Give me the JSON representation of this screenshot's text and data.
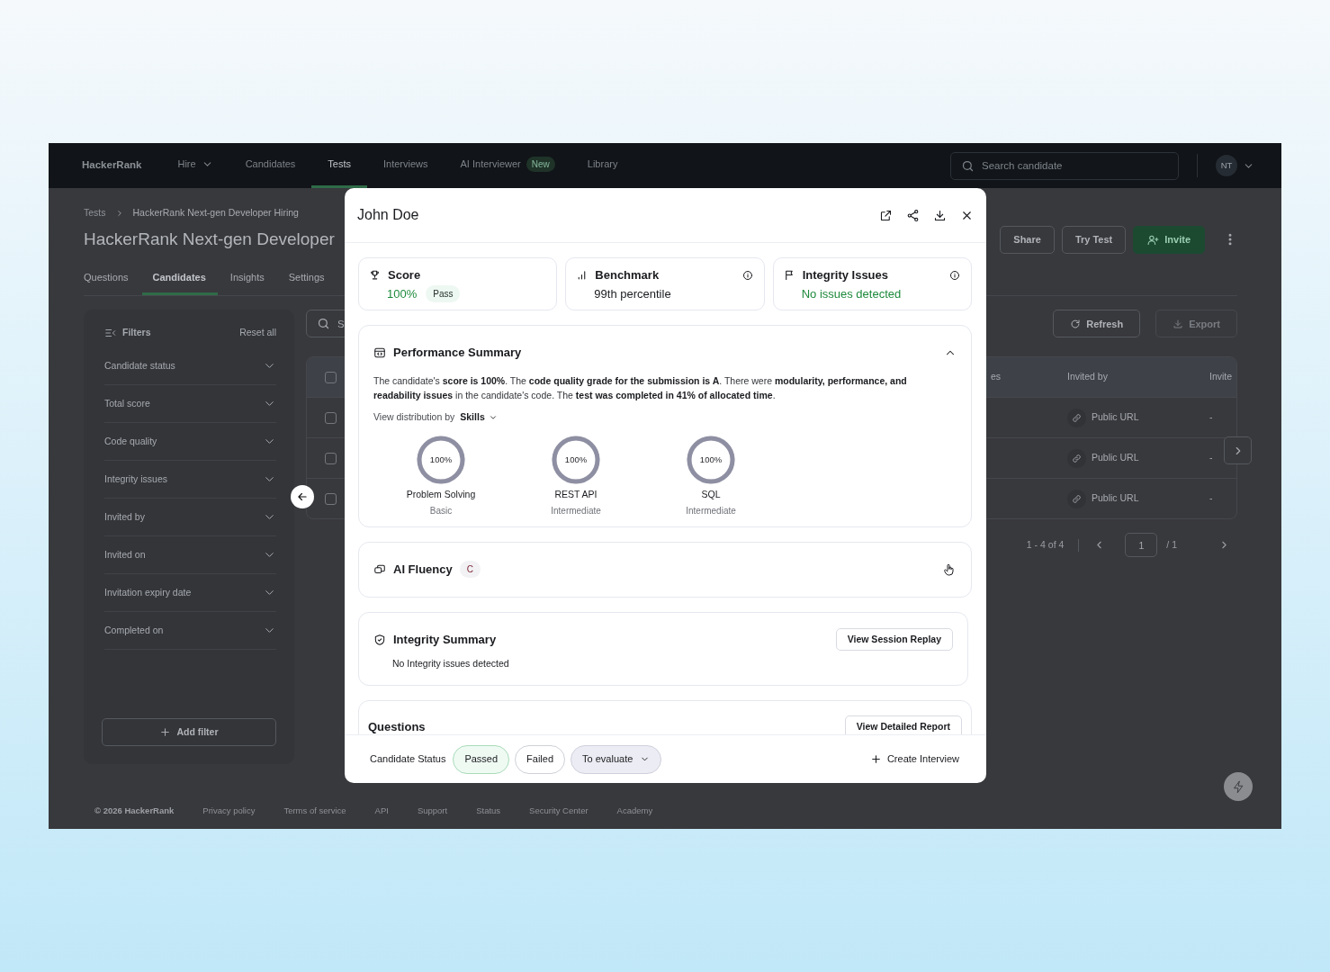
{
  "nav": {
    "logo": "HackerRank",
    "items": [
      {
        "label": "Hire",
        "dropdown": true,
        "selected": false
      },
      {
        "label": "Candidates",
        "dropdown": false,
        "selected": false
      },
      {
        "label": "Tests",
        "dropdown": false,
        "selected": true
      },
      {
        "label": "Interviews",
        "dropdown": false,
        "selected": false
      },
      {
        "label": "AI Interviewer",
        "dropdown": false,
        "selected": false,
        "badge": "New"
      },
      {
        "label": "Library",
        "dropdown": false,
        "selected": false
      }
    ],
    "search": {
      "placeholder": "Search candidate"
    },
    "avatar": "NT"
  },
  "breadcrumb": [
    "Tests",
    "HackerRank Next-gen Developer Hiring"
  ],
  "page_title": "HackerRank Next-gen Developer",
  "header_buttons": [
    {
      "label": "Share",
      "kind": "outline"
    },
    {
      "label": "Try Test",
      "kind": "outline"
    },
    {
      "label": "Invite",
      "kind": "primary"
    }
  ],
  "tabs": [
    {
      "label": "Questions",
      "selected": false
    },
    {
      "label": "Candidates",
      "selected": true
    },
    {
      "label": "Insights",
      "selected": false
    },
    {
      "label": "Settings",
      "selected": false
    }
  ],
  "filters": {
    "title": "Filters",
    "reset": "Reset all",
    "items": [
      "Candidate status",
      "Total score",
      "Code quality",
      "Integrity issues",
      "Invited by",
      "Invited on",
      "Invitation expiry date",
      "Completed on"
    ],
    "add": "Add filter"
  },
  "toolbar": {
    "search_placeholder": "S",
    "buttons": [
      {
        "label": "Refresh",
        "kind": "refresh",
        "disabled": false
      },
      {
        "label": "Export",
        "kind": "export",
        "disabled": true
      }
    ]
  },
  "table": {
    "columns": [
      "es",
      "Invited by",
      "Invite"
    ],
    "header_checked": false,
    "rows": [
      {
        "checked": false,
        "invited_by": "Public URL",
        "invited_on": "-"
      },
      {
        "checked": false,
        "invited_by": "Public URL",
        "invited_on": "-"
      },
      {
        "checked": false,
        "invited_by": "Public URL",
        "invited_on": "-"
      }
    ]
  },
  "pagination": {
    "range": "1 - 4 of 4",
    "page": "1",
    "total": "/ 1"
  },
  "footer": {
    "copyright": "© 2026 HackerRank",
    "links": [
      "Privacy policy",
      "Terms of service",
      "API",
      "Support",
      "Status",
      "Security Center",
      "Academy"
    ]
  },
  "modal": {
    "title": "John Doe",
    "stats": [
      {
        "kind": "score",
        "label": "Score",
        "value": "100%",
        "badge": "Pass",
        "positive": true,
        "info": false
      },
      {
        "kind": "benchmark",
        "label": "Benchmark",
        "value": "99th percentile",
        "positive": false,
        "info": true
      },
      {
        "kind": "integrity",
        "label": "Integrity Issues",
        "value": "No issues detected",
        "positive": true,
        "info": true
      }
    ],
    "performance": {
      "title": "Performance Summary",
      "expanded": true,
      "summary": "The candidate's **score is 100%**. The **code quality grade for the submission is A**. There were **modularity, performance, and readability issues** in the candidate's code. The **test was completed in 41% of allocated time**.",
      "distribution_label": "View distribution by",
      "distribution_value": "Skills",
      "skills": [
        {
          "value": "100%",
          "name": "Problem Solving",
          "grade": "Basic",
          "level": 1
        },
        {
          "value": "100%",
          "name": "REST API",
          "grade": "Intermediate",
          "level": 1
        },
        {
          "value": "100%",
          "name": "SQL",
          "grade": "Intermediate",
          "level": 1
        }
      ]
    },
    "ai_fluency": {
      "title": "AI Fluency",
      "grade": "C"
    },
    "integrity_summary": {
      "title": "Integrity Summary",
      "button": "View Session Replay",
      "text": "No Integrity issues detected"
    },
    "questions": {
      "title": "Questions",
      "button": "View Detailed Report"
    },
    "status": {
      "label": "Candidate Status",
      "options": [
        {
          "label": "Passed",
          "kind": "passed"
        },
        {
          "label": "Failed",
          "kind": "plain"
        },
        {
          "label": "To evaluate",
          "kind": "dropdown"
        }
      ],
      "create": "Create Interview"
    }
  }
}
